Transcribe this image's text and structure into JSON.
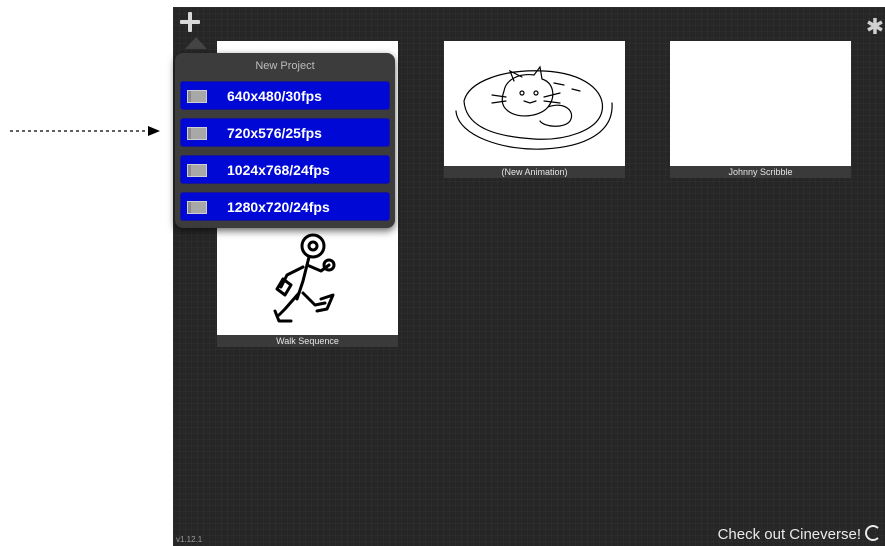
{
  "popover": {
    "title": "New Project",
    "options": [
      {
        "label": "640x480/30fps"
      },
      {
        "label": "720x576/25fps"
      },
      {
        "label": "1024x768/24fps"
      },
      {
        "label": "1280x720/24fps"
      }
    ]
  },
  "projects": [
    {
      "name": "(New Animation)",
      "thumbnail": "cat-sketch"
    },
    {
      "name": "Johnny Scribble",
      "thumbnail": "blank"
    },
    {
      "name": "Walk Sequence",
      "thumbnail": "walking-figure-sketch"
    }
  ],
  "footer": {
    "version": "v1.12.1",
    "cineverse_link": "Check out Cineverse!"
  },
  "icons": {
    "add": "plus-icon",
    "settings": "gear-icon",
    "format": "frame-icon",
    "cineverse": "cineverse-logo-icon"
  },
  "colors": {
    "background": "#262626",
    "option_button": "#0008d6",
    "popover": "#3c3c3c"
  }
}
